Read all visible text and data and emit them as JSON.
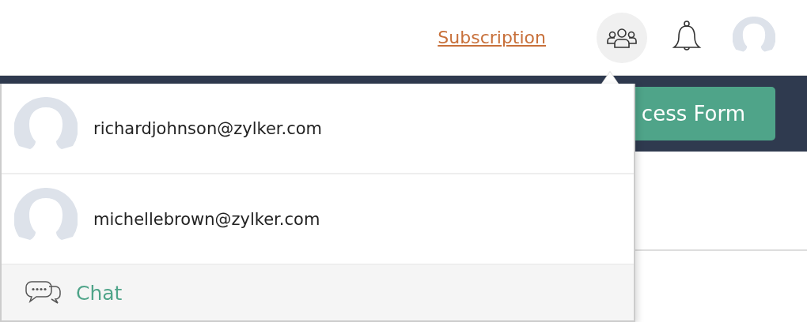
{
  "header": {
    "subscription_link": "Subscription",
    "people_button": {
      "selected": true
    }
  },
  "toolbar": {
    "button": "cess Form"
  },
  "people_menu": {
    "users": [
      {
        "email": "richardjohnson@zylker.com"
      },
      {
        "email": "michellebrown@zylker.com"
      }
    ],
    "chat": "Chat"
  }
}
